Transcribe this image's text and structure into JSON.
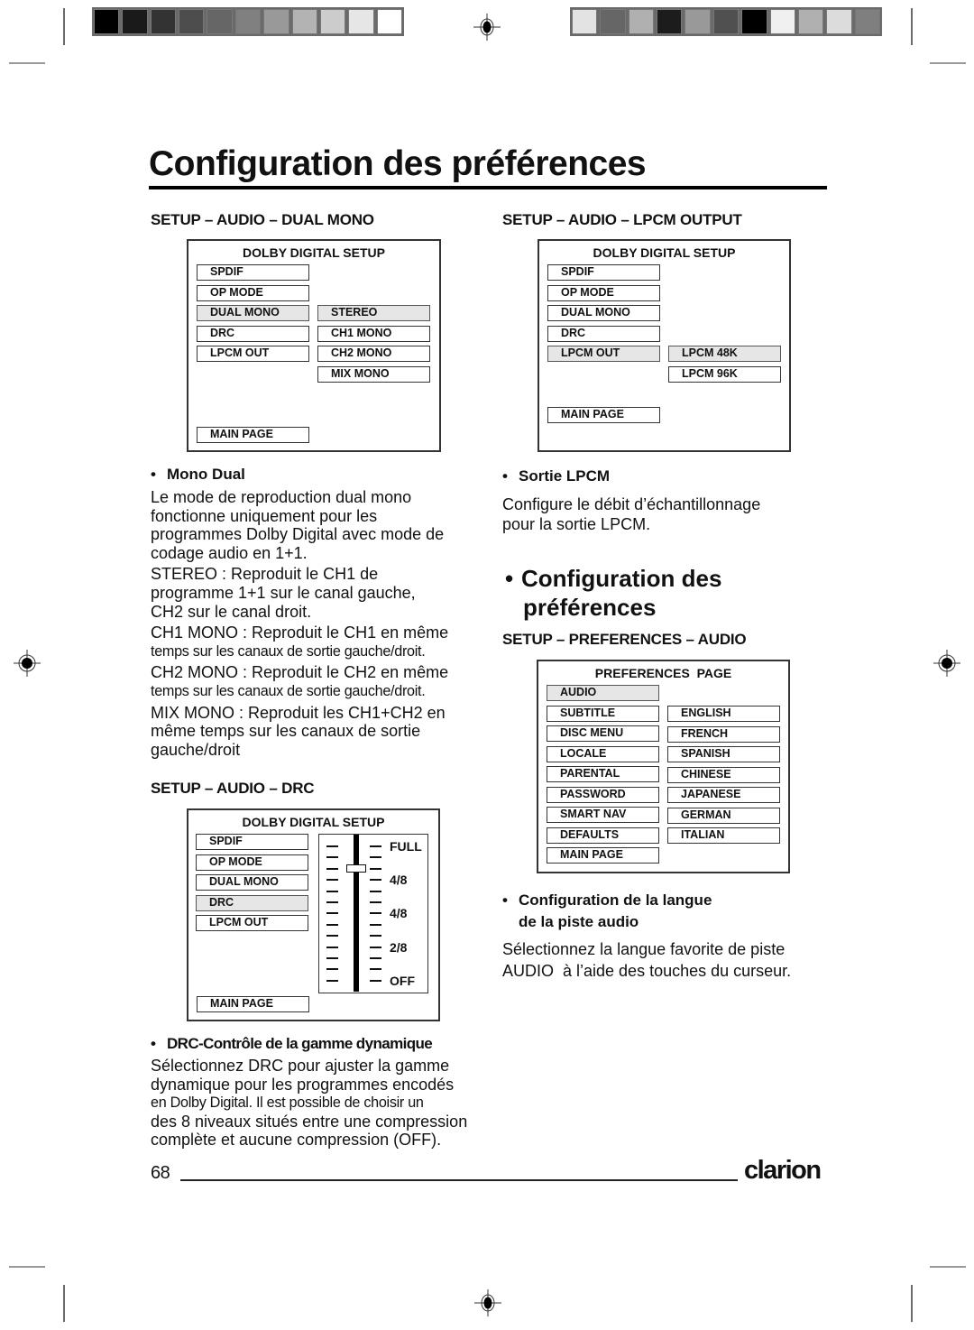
{
  "print_marks": {
    "color_bar_left": [
      "#000000",
      "#1a1a1a",
      "#333333",
      "#4d4d4d",
      "#666666",
      "#808080",
      "#999999",
      "#b3b3b3",
      "#cccccc",
      "#e6e6e6",
      "#ffffff"
    ],
    "color_bar_right": [
      "#e3e3e3",
      "#666666",
      "#b0b0b0",
      "#1c1c1c",
      "#999999",
      "#505050",
      "#000000",
      "#f0f0f0",
      "#b0b0b0",
      "#dcdcdc",
      "#7f7f7f"
    ]
  },
  "page": {
    "title": "Configuration des préférences",
    "page_number": "68",
    "brand": "clarion"
  },
  "left_column": {
    "dual_mono": {
      "heading": "SETUP – AUDIO – DUAL MONO",
      "panel": {
        "title": "DOLBY DIGITAL SETUP",
        "menu": [
          {
            "label": "SPDIF",
            "selected": false
          },
          {
            "label": "OP MODE",
            "selected": false
          },
          {
            "label": "DUAL MONO",
            "selected": true
          },
          {
            "label": "DRC",
            "selected": false
          },
          {
            "label": "LPCM OUT",
            "selected": false
          }
        ],
        "options": [
          {
            "label": "STEREO",
            "selected": true
          },
          {
            "label": "CH1 MONO",
            "selected": false
          },
          {
            "label": "CH2 MONO",
            "selected": false
          },
          {
            "label": "MIX MONO",
            "selected": false
          }
        ],
        "main_page": "MAIN PAGE"
      },
      "bullet": "•",
      "subheading": "Mono Dual",
      "lines": [
        "Le mode de reproduction dual mono",
        "fonctionne uniquement pour les",
        "programmes Dolby Digital avec mode de",
        "codage audio en 1+1.",
        "STEREO : Reproduit le CH1 de",
        "programme 1+1 sur le canal gauche,",
        "CH2 sur le canal droit.",
        "CH1 MONO : Reproduit le CH1 en même",
        "temps sur les canaux de sortie gauche/droit.",
        "CH2 MONO : Reproduit le CH2 en même",
        "temps sur les canaux de sortie gauche/droit.",
        "MIX MONO : Reproduit les CH1+CH2 en",
        "même temps sur les canaux de sortie",
        "gauche/droit"
      ]
    },
    "drc": {
      "heading": "SETUP – AUDIO – DRC",
      "panel": {
        "title": "DOLBY DIGITAL SETUP",
        "menu": [
          {
            "label": "SPDIF",
            "selected": false
          },
          {
            "label": "OP MODE",
            "selected": false
          },
          {
            "label": "DUAL MONO",
            "selected": false
          },
          {
            "label": "DRC",
            "selected": true
          },
          {
            "label": "LPCM OUT",
            "selected": false
          }
        ],
        "main_page": "MAIN PAGE",
        "slider": {
          "tick_count": 13,
          "knob_tick_index_from_top": 2,
          "labels": [
            {
              "text": "FULL",
              "tick": 0
            },
            {
              "text": "4/8",
              "tick": 3
            },
            {
              "text": "4/8",
              "tick": 6
            },
            {
              "text": "2/8",
              "tick": 9
            },
            {
              "text": "OFF",
              "tick": 12
            }
          ]
        }
      },
      "bullet": "•",
      "subheading": "DRC-Contrôle de la gamme dynamique",
      "lines": [
        "Sélectionnez DRC pour ajuster la gamme",
        "dynamique pour les programmes encodés",
        "en Dolby Digital. Il est possible de choisir un",
        "des 8 niveaux situés entre une compression",
        "complète et aucune compression (OFF)."
      ]
    }
  },
  "right_column": {
    "lpcm": {
      "heading": "SETUP – AUDIO – LPCM OUTPUT",
      "panel": {
        "title": "DOLBY DIGITAL SETUP",
        "menu": [
          {
            "label": "SPDIF",
            "selected": false
          },
          {
            "label": "OP MODE",
            "selected": false
          },
          {
            "label": "DUAL MONO",
            "selected": false
          },
          {
            "label": "DRC",
            "selected": false
          },
          {
            "label": "LPCM OUT",
            "selected": true
          }
        ],
        "options": [
          {
            "label": "LPCM 48K",
            "selected": true
          },
          {
            "label": "LPCM 96K",
            "selected": false
          }
        ],
        "main_page": "MAIN PAGE"
      },
      "bullet": "•",
      "subheading": "Sortie LPCM",
      "lines": [
        "Configure le débit d’échantillonnage",
        "pour la sortie LPCM."
      ]
    },
    "preferences": {
      "bullet": "•",
      "title_line1": "Configuration des",
      "title_line2": "préférences",
      "heading": "SETUP – PREFERENCES – AUDIO",
      "panel": {
        "title": "PREFERENCES  PAGE",
        "menu": [
          {
            "label": "AUDIO",
            "selected": true
          },
          {
            "label": "SUBTITLE",
            "selected": false
          },
          {
            "label": "DISC MENU",
            "selected": false
          },
          {
            "label": "LOCALE",
            "selected": false
          },
          {
            "label": "PARENTAL",
            "selected": false
          },
          {
            "label": "PASSWORD",
            "selected": false
          },
          {
            "label": "SMART NAV",
            "selected": false
          },
          {
            "label": "DEFAULTS",
            "selected": false
          },
          {
            "label": "MAIN PAGE",
            "selected": false
          }
        ],
        "options": [
          {
            "label": "ENGLISH",
            "selected": false
          },
          {
            "label": "FRENCH",
            "selected": false
          },
          {
            "label": "SPANISH",
            "selected": false
          },
          {
            "label": "CHINESE",
            "selected": false
          },
          {
            "label": "JAPANESE",
            "selected": false
          },
          {
            "label": "GERMAN",
            "selected": false
          },
          {
            "label": "ITALIAN",
            "selected": false
          }
        ]
      },
      "sub_bullet": "•",
      "subheading_line1": "Configuration de la langue",
      "subheading_line2": "de la piste audio",
      "lines": [
        "Sélectionnez la langue favorite de piste",
        "AUDIO  à l’aide des touches du curseur."
      ]
    }
  }
}
